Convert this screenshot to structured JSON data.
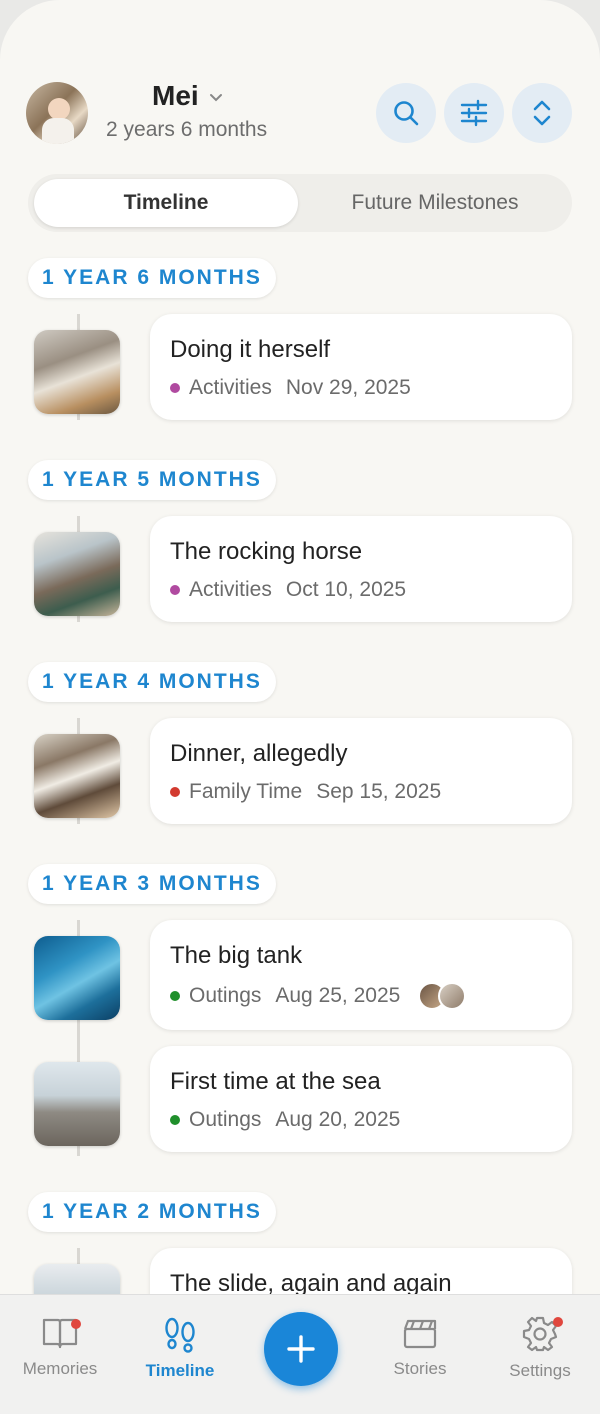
{
  "header": {
    "name": "Mei",
    "age": "2 years 6 months"
  },
  "tabs": {
    "active": "Timeline",
    "other": "Future Milestones"
  },
  "sections": [
    {
      "label": "1 YEAR 6 MONTHS",
      "entries": [
        {
          "title": "Doing it herself",
          "category": "Activities",
          "date": "Nov 29, 2025",
          "category_color": "#b04aa0"
        }
      ]
    },
    {
      "label": "1 YEAR 5 MONTHS",
      "entries": [
        {
          "title": "The rocking horse",
          "category": "Activities",
          "date": "Oct 10, 2025",
          "category_color": "#b04aa0"
        }
      ]
    },
    {
      "label": "1 YEAR 4 MONTHS",
      "entries": [
        {
          "title": "Dinner, allegedly",
          "category": "Family Time",
          "date": "Sep 15, 2025",
          "category_color": "#d23a2f"
        }
      ]
    },
    {
      "label": "1 YEAR 3 MONTHS",
      "entries": [
        {
          "title": "The big tank",
          "category": "Outings",
          "date": "Aug 25, 2025",
          "category_color": "#1f8f2b"
        },
        {
          "title": "First time at the sea",
          "category": "Outings",
          "date": "Aug 20, 2025",
          "category_color": "#1f8f2b"
        }
      ]
    },
    {
      "label": "1 YEAR 2 MONTHS",
      "entries": [
        {
          "title": "The slide, again and again",
          "category": "",
          "date": "",
          "category_color": ""
        }
      ]
    }
  ],
  "nav": {
    "memories": "Memories",
    "timeline": "Timeline",
    "stories": "Stories",
    "settings": "Settings"
  },
  "colors": {
    "accent": "#1e86cf",
    "fab": "#1a86d8",
    "badge": "#e0473e"
  }
}
